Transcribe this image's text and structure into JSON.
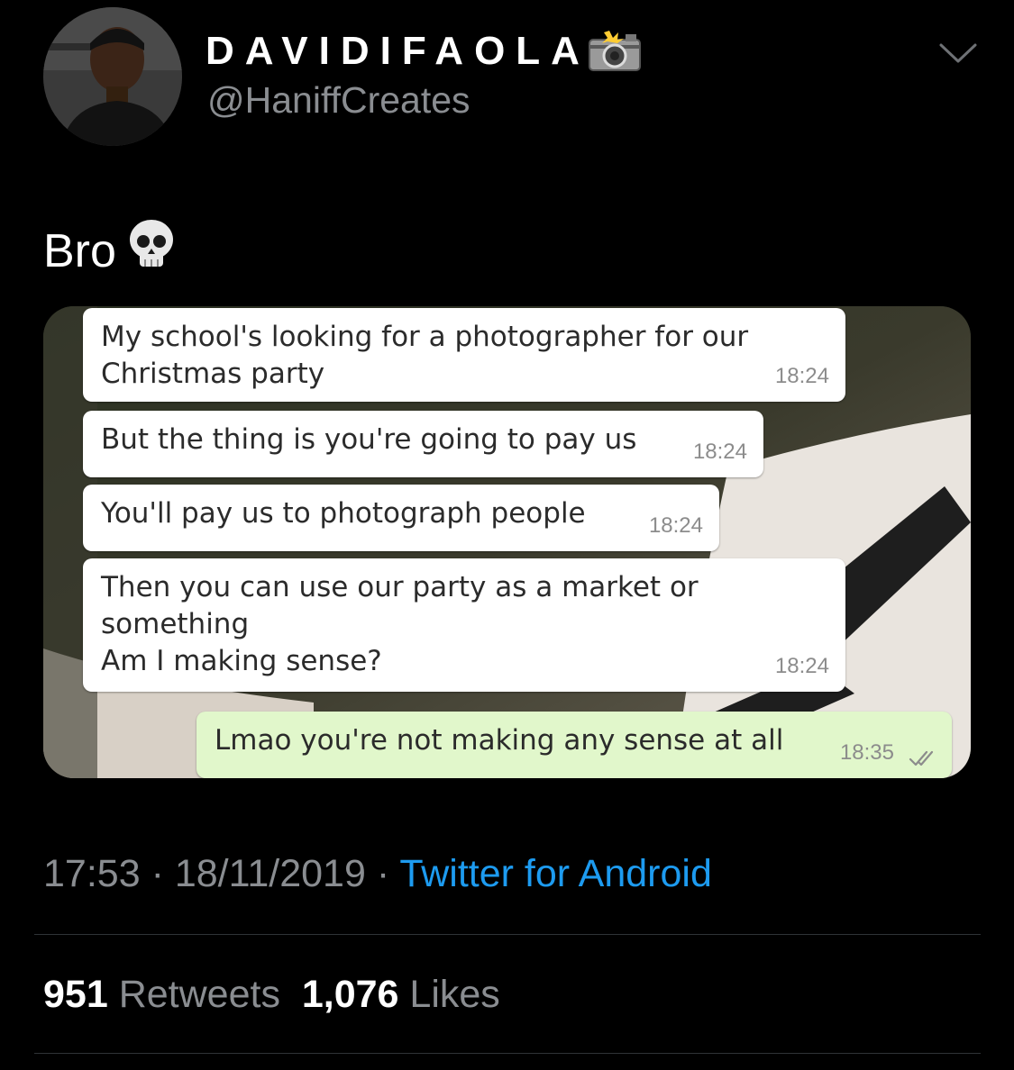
{
  "tweet": {
    "display_name": "DAVIDIFAOLA",
    "handle": "@HaniffCreates",
    "text": "Bro",
    "icons": {
      "name_emoji": "camera-with-flash-icon",
      "text_emoji": "skull-icon",
      "menu": "chevron-down-icon"
    },
    "timestamp": {
      "time": "17:53",
      "date": "18/11/2019",
      "separator": "·",
      "source": "Twitter for Android"
    },
    "stats": {
      "retweets_count": "951",
      "retweets_label": "Retweets",
      "likes_count": "1,076",
      "likes_label": "Likes"
    }
  },
  "chat": {
    "messages": [
      {
        "text": "My school's looking for a photographer for our\nChristmas party",
        "time": "18:24",
        "direction": "incoming"
      },
      {
        "text": "But the thing is you're going to pay us",
        "time": "18:24",
        "direction": "incoming"
      },
      {
        "text": "You'll pay us to photograph people",
        "time": "18:24",
        "direction": "incoming"
      },
      {
        "text": "Then you can use our party as a market or\nsomething\nAm I making sense?",
        "time": "18:24",
        "direction": "incoming"
      },
      {
        "text": "Lmao you're not making any sense at all",
        "time": "18:35",
        "direction": "outgoing",
        "status_icon": "double-check-icon"
      }
    ]
  },
  "colors": {
    "background": "#000000",
    "secondary_text": "#8a8d91",
    "link": "#1d9bf0",
    "divider": "#2f3336",
    "outgoing_bubble": "#e1f7cb",
    "incoming_bubble": "#ffffff"
  }
}
